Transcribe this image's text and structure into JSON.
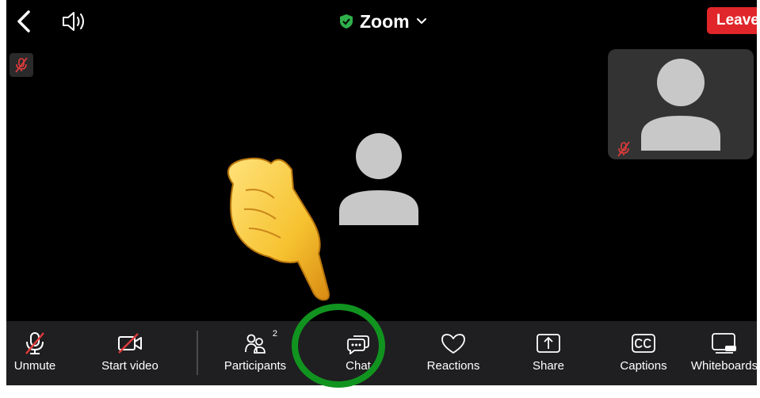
{
  "header": {
    "title": "Zoom",
    "leave_label": "Leave",
    "icons": {
      "back": "chevron-left-icon",
      "speaker": "speaker-icon",
      "security": "shield-check-icon",
      "dropdown": "chevron-down-icon"
    }
  },
  "toolbar": {
    "items": [
      {
        "label": "Unmute",
        "icon": "mic-muted-icon"
      },
      {
        "label": "Start video",
        "icon": "video-off-icon"
      },
      {
        "label": "Participants",
        "icon": "participants-icon",
        "count": "2"
      },
      {
        "label": "Chat",
        "icon": "chat-icon"
      },
      {
        "label": "Reactions",
        "icon": "heart-icon"
      },
      {
        "label": "Share",
        "icon": "share-icon"
      },
      {
        "label": "Captions",
        "icon": "cc-icon"
      },
      {
        "label": "Whiteboards",
        "icon": "whiteboard-icon"
      }
    ]
  },
  "colors": {
    "background": "#000000",
    "toolbar": "#1f1f21",
    "leave": "#e0262a",
    "shield": "#2fb04a",
    "muted": "#e23b3b",
    "avatar": "#c8c8c8",
    "thumbnail": "#333333",
    "highlight": "#11941f"
  }
}
